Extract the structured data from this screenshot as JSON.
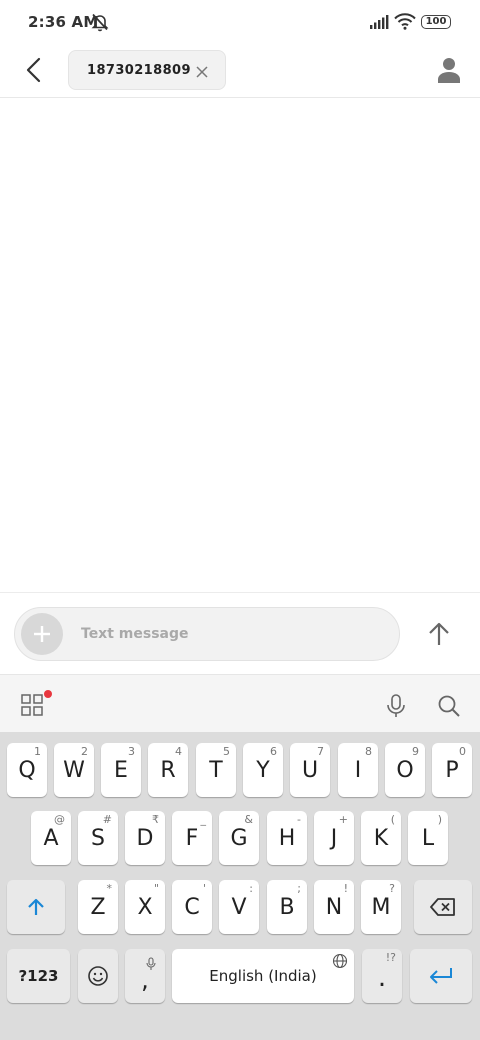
{
  "status_bar": {
    "time": "2:36 AM",
    "battery": "100",
    "icons": [
      "muted-bell-icon",
      "signal-icon",
      "wifi-icon",
      "battery-icon"
    ]
  },
  "header": {
    "back_icon": "back-arrow-icon",
    "recipient": "18730218809",
    "chip_close_icon": "close-icon",
    "contact_icon": "person-icon"
  },
  "compose": {
    "placeholder": "Text message",
    "attach_icon": "plus-icon",
    "send_icon": "arrow-up-icon"
  },
  "keyboard_toolbar": {
    "icons": [
      "apps-grid-icon",
      "microphone-icon",
      "search-icon"
    ],
    "notification_dot_color": "#e8373f"
  },
  "keyboard": {
    "row1": [
      {
        "key": "Q",
        "hint": "1"
      },
      {
        "key": "W",
        "hint": "2"
      },
      {
        "key": "E",
        "hint": "3"
      },
      {
        "key": "R",
        "hint": "4"
      },
      {
        "key": "T",
        "hint": "5"
      },
      {
        "key": "Y",
        "hint": "6"
      },
      {
        "key": "U",
        "hint": "7"
      },
      {
        "key": "I",
        "hint": "8"
      },
      {
        "key": "O",
        "hint": "9"
      },
      {
        "key": "P",
        "hint": "0"
      }
    ],
    "row2": [
      {
        "key": "A",
        "hint": "@"
      },
      {
        "key": "S",
        "hint": "#"
      },
      {
        "key": "D",
        "hint": "₹"
      },
      {
        "key": "F",
        "hint": "_"
      },
      {
        "key": "G",
        "hint": "&"
      },
      {
        "key": "H",
        "hint": "-"
      },
      {
        "key": "J",
        "hint": "+"
      },
      {
        "key": "K",
        "hint": "("
      },
      {
        "key": "L",
        "hint": ")"
      }
    ],
    "row3": [
      {
        "key": "Z",
        "hint": "*"
      },
      {
        "key": "X",
        "hint": "\""
      },
      {
        "key": "C",
        "hint": "'"
      },
      {
        "key": "V",
        "hint": ":"
      },
      {
        "key": "B",
        "hint": ";"
      },
      {
        "key": "N",
        "hint": "!"
      },
      {
        "key": "M",
        "hint": "?"
      }
    ],
    "shift_icon": "shift-arrow-icon",
    "backspace_icon": "backspace-icon",
    "symbols_label": "?123",
    "emoji_icon": "emoji-icon",
    "comma": ",",
    "space_label": "English (India)",
    "period": ".",
    "period_hint": "!?",
    "enter_icon": "enter-icon",
    "accent_color": "#1a87d6"
  }
}
